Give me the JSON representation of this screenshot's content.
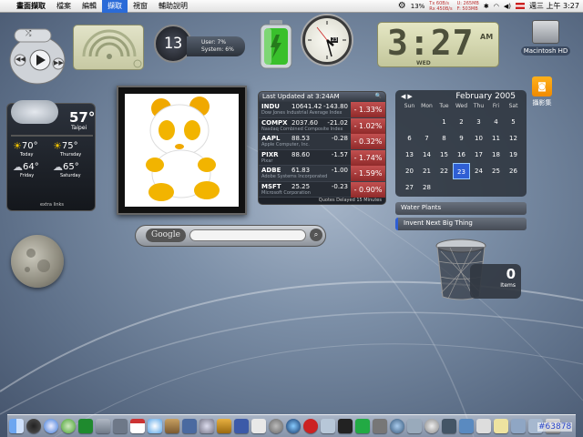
{
  "menubar": {
    "items": [
      "畫面擷取",
      "檔案",
      "編輯",
      "擷取",
      "視窗",
      "輔助說明"
    ],
    "selected_index": 3,
    "cpu_percent": "13%",
    "net": {
      "tx": "Tx  60B/s",
      "rx": "Rx  450B/s",
      "used": "U: 265MB",
      "free": "F: 503MB"
    },
    "clock": "週三 上午 3:27"
  },
  "cpu_widget": {
    "number": "13",
    "user": "User: 7%",
    "system": "System: 6%"
  },
  "lcd_clock": {
    "time": "3:27",
    "ampm": "AM",
    "day": "WED"
  },
  "clock_widget": {
    "date": "23"
  },
  "hard_drive": {
    "label": "Macintosh HD"
  },
  "weather": {
    "current_temp": "57°",
    "city": "Taipei",
    "days": [
      {
        "label": "Today",
        "temp": "70°"
      },
      {
        "label": "Thursday",
        "temp": "75°"
      },
      {
        "label": "Friday",
        "temp": "64°"
      },
      {
        "label": "Saturday",
        "temp": "65°"
      }
    ],
    "footer": "extra links"
  },
  "stocks": {
    "header": "Last Updated at 3:24AM",
    "rows": [
      {
        "sym": "INDU",
        "price": "10641.42",
        "chg": "-143.80",
        "pct": "- 1.33%",
        "name": "Dow Jones Industrial Average Index"
      },
      {
        "sym": "COMPX",
        "price": "2037.60",
        "chg": "-21.02",
        "pct": "- 1.02%",
        "name": "Nasdaq Combined Composite Index"
      },
      {
        "sym": "AAPL",
        "price": "88.53",
        "chg": "-0.28",
        "pct": "- 0.32%",
        "name": "Apple Computer, Inc."
      },
      {
        "sym": "PIXR",
        "price": "88.60",
        "chg": "-1.57",
        "pct": "- 1.74%",
        "name": "Pixar"
      },
      {
        "sym": "ADBE",
        "price": "61.83",
        "chg": "-1.00",
        "pct": "- 1.59%",
        "name": "Adobe Systems Incorporated"
      },
      {
        "sym": "MSFT",
        "price": "25.25",
        "chg": "-0.23",
        "pct": "- 0.90%",
        "name": "Microsoft Corporation"
      }
    ],
    "footer": "Quotes Delayed 15 Minutes"
  },
  "calendar": {
    "month": "February 2005",
    "weekdays": [
      "Sun",
      "Mon",
      "Tue",
      "Wed",
      "Thu",
      "Fri",
      "Sat"
    ],
    "weeks": [
      [
        "",
        "",
        "1",
        "2",
        "3",
        "4",
        "5"
      ],
      [
        "6",
        "7",
        "8",
        "9",
        "10",
        "11",
        "12"
      ],
      [
        "13",
        "14",
        "15",
        "16",
        "17",
        "18",
        "19"
      ],
      [
        "20",
        "21",
        "22",
        "23",
        "24",
        "25",
        "26"
      ],
      [
        "27",
        "28",
        "",
        "",
        "",
        "",
        ""
      ]
    ],
    "today": "23"
  },
  "todo": {
    "items": [
      "Water Plants",
      "Invent Next Big Thing"
    ]
  },
  "desktop_file": {
    "label": "攝影集"
  },
  "google": {
    "logo": "Google"
  },
  "trash": {
    "count": "0",
    "label": "Items"
  },
  "tag": "#63878",
  "colors": {
    "accent": "#2a6bd8",
    "stock_bad": "#b03a3a",
    "battery": "#39c02c",
    "calendar_today": "#2f5fd4"
  }
}
